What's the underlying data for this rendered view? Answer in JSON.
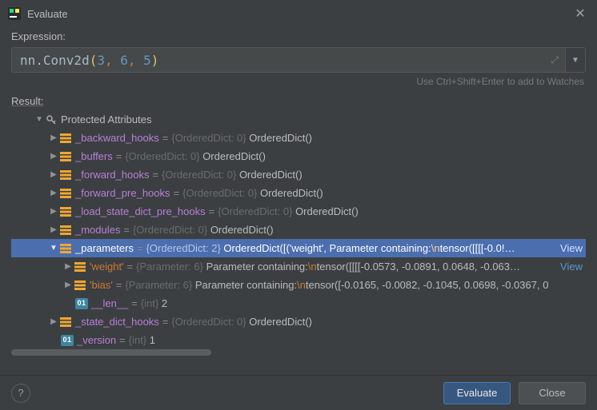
{
  "window": {
    "title": "Evaluate"
  },
  "expression": {
    "label": "Expression:",
    "code": {
      "prefix": "nn.Conv2d",
      "args": [
        "3",
        "6",
        "5"
      ]
    }
  },
  "hint": "Use Ctrl+Shift+Enter to add to Watches",
  "result": {
    "label": "Result:",
    "group": "Protected Attributes",
    "items": [
      {
        "name": "_backward_hooks",
        "type": "{OrderedDict: 0}",
        "value": "OrderedDict()"
      },
      {
        "name": "_buffers",
        "type": "{OrderedDict: 0}",
        "value": "OrderedDict()"
      },
      {
        "name": "_forward_hooks",
        "type": "{OrderedDict: 0}",
        "value": "OrderedDict()"
      },
      {
        "name": "_forward_pre_hooks",
        "type": "{OrderedDict: 0}",
        "value": "OrderedDict()"
      },
      {
        "name": "_load_state_dict_pre_hooks",
        "type": "{OrderedDict: 0}",
        "value": "OrderedDict()"
      },
      {
        "name": "_modules",
        "type": "{OrderedDict: 0}",
        "value": "OrderedDict()"
      }
    ],
    "parameters": {
      "name": "_parameters",
      "type": "{OrderedDict: 2}",
      "value_prefix": "OrderedDict([('weight', Parameter containing:",
      "value_esc": "\\n",
      "value_suffix": "tensor([[[[-0.0!…",
      "view": "View",
      "children": [
        {
          "key": "'weight'",
          "type": "{Parameter: 6}",
          "val_prefix": "Parameter containing:",
          "esc": "\\n",
          "val_suffix": "tensor([[[[-0.0573, -0.0891,  0.0648, -0.063…",
          "view": "View"
        },
        {
          "key": "'bias'",
          "type": "{Parameter: 6}",
          "val_prefix": "Parameter containing:",
          "esc": "\\n",
          "val_suffix": "tensor([-0.0165, -0.0082, -0.1045,  0.0698, -0.0367,  0"
        }
      ],
      "len": {
        "name": "__len__",
        "type": "{int}",
        "value": "2"
      }
    },
    "after": [
      {
        "name": "_state_dict_hooks",
        "type": "{OrderedDict: 0}",
        "value": "OrderedDict()"
      }
    ],
    "version": {
      "name": "_version",
      "type": "{int}",
      "value": "1"
    }
  },
  "buttons": {
    "help": "?",
    "evaluate": "Evaluate",
    "close": "Close"
  }
}
